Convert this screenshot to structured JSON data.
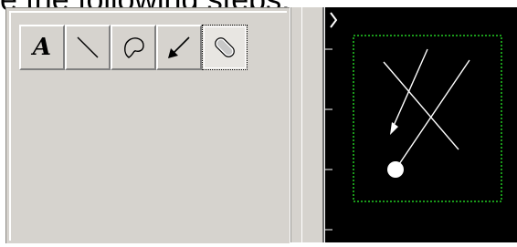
{
  "caption": "e the following steps:",
  "toolbar": {
    "tools": [
      {
        "label": "A",
        "icon": "text-tool-icon"
      },
      {
        "icon": "line-tool-icon"
      },
      {
        "icon": "freehand-shape-tool-icon"
      },
      {
        "icon": "arrow-tool-icon"
      },
      {
        "icon": "eraser-tool-icon"
      }
    ],
    "active_tool": "eraser"
  },
  "colors": {
    "panel": "#d6d3ce",
    "canvas": "#000000",
    "selection": "#22cc22",
    "drawing": "#ffffff"
  }
}
